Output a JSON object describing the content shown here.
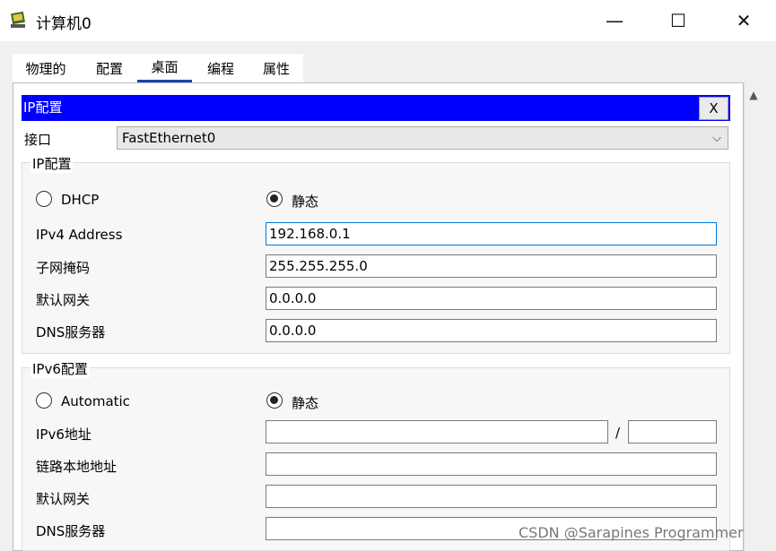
{
  "window": {
    "title": "计算机0",
    "minimize": "—",
    "maximize": "☐",
    "close": "✕"
  },
  "tabs": [
    "物理的",
    "配置",
    "桌面",
    "编程",
    "属性"
  ],
  "active_tab": "桌面",
  "subwindow": {
    "title": "IP配置",
    "close_label": "X"
  },
  "interface": {
    "label": "接口",
    "value": "FastEthernet0"
  },
  "ipv4": {
    "group_title": "IP配置",
    "dhcp_label": "DHCP",
    "static_label": "静态",
    "address_label": "IPv4 Address",
    "address_value": "192.168.0.1",
    "mask_label": "子网掩码",
    "mask_value": "255.255.255.0",
    "gateway_label": "默认网关",
    "gateway_value": "0.0.0.0",
    "dns_label": "DNS服务器",
    "dns_value": "0.0.0.0"
  },
  "ipv6": {
    "group_title": "IPv6配置",
    "auto_label": "Automatic",
    "static_label": "静态",
    "address_label": "IPv6地址",
    "slash": "/",
    "linklocal_label": "链路本地地址",
    "gateway_label": "默认网关",
    "dns_label": "DNS服务器"
  },
  "watermark": "CSDN @Sarapines Programmer",
  "colors": {
    "title_bar": "#0000ff",
    "tab_underline": "#1f3fb0",
    "focus": "#0078d7"
  }
}
